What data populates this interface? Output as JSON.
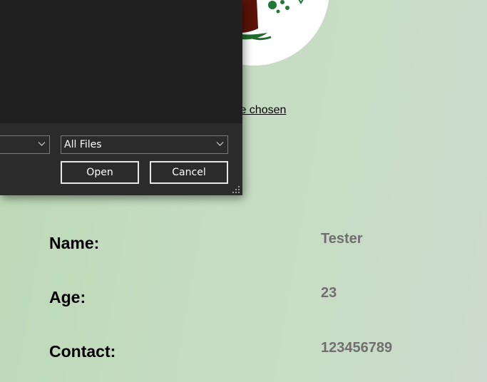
{
  "profile": {
    "file_status": "No file chosen",
    "name": "Tester",
    "name_visible": "ster"
  },
  "fields": [
    {
      "label": "Name:",
      "value": "Tester"
    },
    {
      "label": "Age:",
      "value": "23"
    },
    {
      "label": "Contact:",
      "value": "123456789"
    }
  ],
  "dialog": {
    "file_type_filter": "All Files",
    "open_label": "Open",
    "cancel_label": "Cancel",
    "colors": {
      "body": "#202020",
      "footer": "#2b2b2b",
      "border": "#e6e6e6"
    }
  },
  "icons": {
    "dropdown": "chevron-down-icon",
    "resize": "resize-grip-icon",
    "avatar": "profile-avatar-icon"
  }
}
